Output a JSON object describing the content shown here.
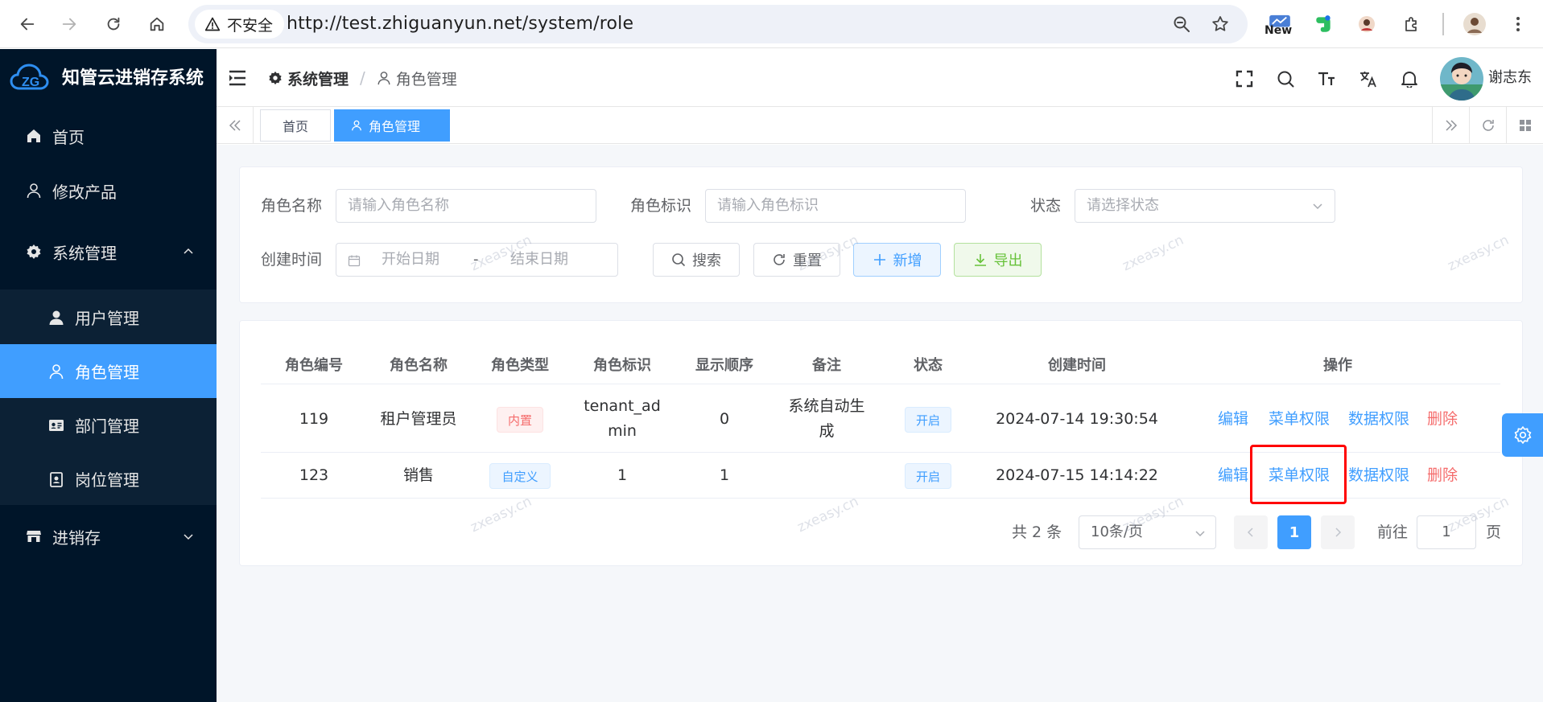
{
  "browser": {
    "security_label": "不安全",
    "url": "http://test.zhiguanyun.net/system/role",
    "extension_new_label": "New"
  },
  "sidebar": {
    "app_title": "知管云进销存系统",
    "items": [
      {
        "label": "首页",
        "icon": "home-icon"
      },
      {
        "label": "修改产品",
        "icon": "user-icon"
      },
      {
        "label": "系统管理",
        "icon": "gear-icon",
        "expanded": true
      },
      {
        "label": "进销存",
        "icon": "store-icon",
        "expanded": false
      }
    ],
    "submenu": [
      {
        "label": "用户管理",
        "icon": "user-filled-icon"
      },
      {
        "label": "角色管理",
        "icon": "user-icon",
        "active": true
      },
      {
        "label": "部门管理",
        "icon": "id-card-icon"
      },
      {
        "label": "岗位管理",
        "icon": "post-icon"
      }
    ]
  },
  "header": {
    "breadcrumb": [
      "系统管理",
      "角色管理"
    ],
    "user_name": "谢志东"
  },
  "tags": [
    "首页",
    "角色管理"
  ],
  "search_form": {
    "role_name_label": "角色名称",
    "role_name_placeholder": "请输入角色名称",
    "role_key_label": "角色标识",
    "role_key_placeholder": "请输入角色标识",
    "status_label": "状态",
    "status_placeholder": "请选择状态",
    "created_label": "创建时间",
    "start_date_placeholder": "开始日期",
    "date_separator": "-",
    "end_date_placeholder": "结束日期",
    "search_button": "搜索",
    "reset_button": "重置",
    "add_button": "新增",
    "export_button": "导出"
  },
  "table": {
    "headers": [
      "角色编号",
      "角色名称",
      "角色类型",
      "角色标识",
      "显示顺序",
      "备注",
      "状态",
      "创建时间",
      "操作"
    ],
    "rows": [
      {
        "id": "119",
        "name": "租户管理员",
        "type": "内置",
        "key_line1": "tenant_ad",
        "key_line2": "min",
        "order": "0",
        "remark_line1": "系统自动生",
        "remark_line2": "成",
        "status": "开启",
        "created": "2024-07-14 19:30:54"
      },
      {
        "id": "123",
        "name": "销售",
        "type": "自定义",
        "key_line1": "1",
        "key_line2": "",
        "order": "1",
        "remark_line1": "",
        "remark_line2": "",
        "status": "开启",
        "created": "2024-07-15 14:14:22"
      }
    ],
    "actions": {
      "edit": "编辑",
      "menu_perm": "菜单权限",
      "data_perm": "数据权限",
      "delete": "删除"
    }
  },
  "pagination": {
    "total_text": "共 2 条",
    "page_size": "10条/页",
    "current_page": "1",
    "goto_label": "前往",
    "goto_value": "1",
    "page_suffix": "页"
  },
  "watermark_text": "zxeasy.cn",
  "colors": {
    "primary": "#409eff",
    "sidebar_bg": "#001529",
    "danger": "#f56c6c",
    "success": "#67c23a",
    "highlight": "#ff0000"
  }
}
